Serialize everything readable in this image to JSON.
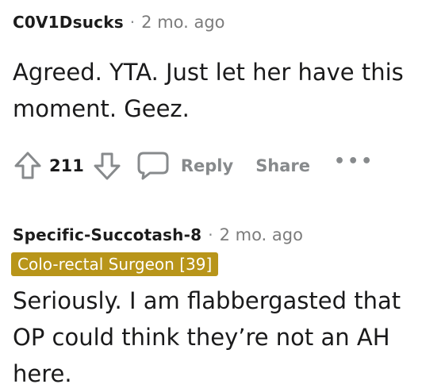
{
  "comments": [
    {
      "author": "C0V1Dsucks",
      "separator": "·",
      "age": "2 mo. ago",
      "body": "Agreed. YTA. Just let her have this moment. Geez.",
      "votes": "211",
      "reply_label": "Reply",
      "share_label": "Share",
      "more_label": "•••"
    },
    {
      "author": "Specific-Succotash-8",
      "separator": "·",
      "age": "2 mo. ago",
      "flair": "Colo-rectal Surgeon [39]",
      "flair_color": "#b8951a",
      "body": "Seriously. I am flabbergasted that OP could think they’re not an AH here."
    }
  ],
  "icons": {
    "upvote": "upvote-arrow-icon",
    "downvote": "downvote-arrow-icon",
    "reply": "speech-bubble-icon",
    "more": "more-options-icon"
  },
  "colors": {
    "text": "#1a1a1b",
    "muted": "#878a8c"
  }
}
